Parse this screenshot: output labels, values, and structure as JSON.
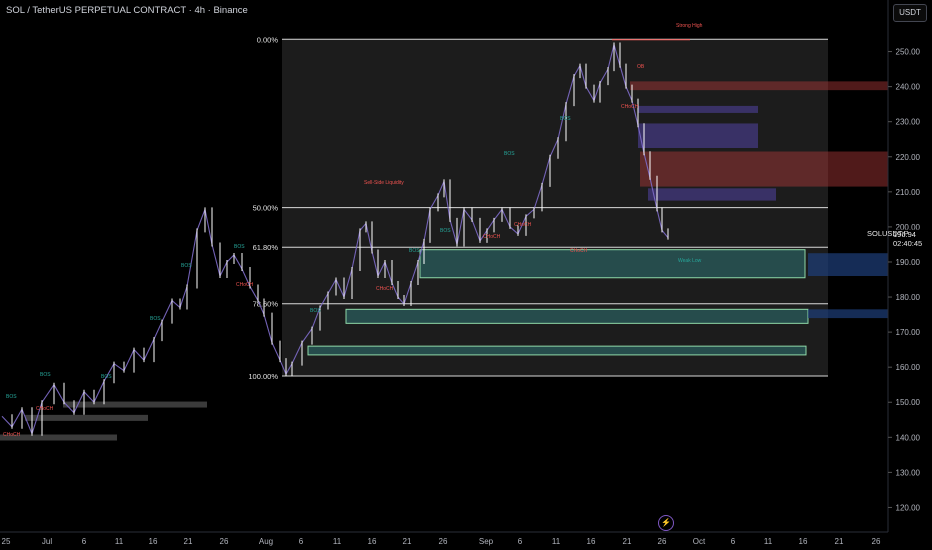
{
  "header": {
    "title": "SOL / TetherUS PERPETUAL CONTRACT · 4h · Binance",
    "currency_button": "USDT"
  },
  "price_tag": {
    "symbol": "SOLUSDT.P",
    "price": "196.94",
    "countdown": "02:40:45"
  },
  "icons": {
    "lightning": "lightning-icon"
  },
  "colors": {
    "background": "#000000",
    "candle": "#ffffff",
    "wick_line": "#7e6cc9",
    "fib_line": "#d9d9d9",
    "zone_green": "#8fd9a8",
    "zone_teal": "#3aa6a6",
    "zone_red": "#b23a3a",
    "zone_purple": "#4a3d8f",
    "bos_green": "#26a69a",
    "choch_red": "#ef5350"
  },
  "chart_data": {
    "type": "candlestick",
    "symbol": "SOL / TetherUS PERPETUAL CONTRACT",
    "timeframe": "4h",
    "exchange": "Binance",
    "y_axis": {
      "ticks": [
        120,
        130,
        140,
        150,
        160,
        170,
        180,
        190,
        200,
        210,
        220,
        230,
        240,
        250
      ],
      "range": [
        113,
        259
      ],
      "side": "right"
    },
    "x_axis": {
      "tick_labels": [
        "25",
        "Jul",
        "6",
        "11",
        "16",
        "21",
        "26",
        "Aug",
        "6",
        "11",
        "16",
        "21",
        "26",
        "Sep",
        "6",
        "11",
        "16",
        "21",
        "26",
        "Oct",
        "6",
        "11",
        "16",
        "21",
        "26"
      ]
    },
    "last_price": 196.94,
    "price_path": [
      [
        0,
        146
      ],
      [
        10,
        143
      ],
      [
        20,
        148
      ],
      [
        30,
        141
      ],
      [
        40,
        150
      ],
      [
        52,
        155
      ],
      [
        62,
        150
      ],
      [
        72,
        147
      ],
      [
        82,
        153
      ],
      [
        92,
        150
      ],
      [
        102,
        156
      ],
      [
        112,
        161
      ],
      [
        122,
        159
      ],
      [
        132,
        165
      ],
      [
        142,
        162
      ],
      [
        152,
        168
      ],
      [
        160,
        173
      ],
      [
        170,
        179
      ],
      [
        178,
        177
      ],
      [
        185,
        183
      ],
      [
        195,
        199
      ],
      [
        203,
        205
      ],
      [
        210,
        195
      ],
      [
        218,
        186
      ],
      [
        225,
        190
      ],
      [
        232,
        192
      ],
      [
        240,
        188
      ],
      [
        248,
        183
      ],
      [
        256,
        179
      ],
      [
        262,
        175
      ],
      [
        270,
        167
      ],
      [
        278,
        162
      ],
      [
        284,
        158
      ],
      [
        290,
        161
      ],
      [
        300,
        167
      ],
      [
        310,
        171
      ],
      [
        318,
        177
      ],
      [
        326,
        181
      ],
      [
        334,
        185
      ],
      [
        342,
        180
      ],
      [
        350,
        188
      ],
      [
        358,
        199
      ],
      [
        364,
        201
      ],
      [
        370,
        193
      ],
      [
        376,
        186
      ],
      [
        383,
        190
      ],
      [
        390,
        184
      ],
      [
        396,
        180
      ],
      [
        402,
        178
      ],
      [
        409,
        184
      ],
      [
        416,
        190
      ],
      [
        422,
        196
      ],
      [
        428,
        205
      ],
      [
        436,
        209
      ],
      [
        442,
        213
      ],
      [
        448,
        202
      ],
      [
        455,
        195
      ],
      [
        462,
        205
      ],
      [
        470,
        202
      ],
      [
        478,
        196
      ],
      [
        485,
        199
      ],
      [
        492,
        202
      ],
      [
        500,
        205
      ],
      [
        508,
        200
      ],
      [
        516,
        198
      ],
      [
        524,
        203
      ],
      [
        532,
        205
      ],
      [
        540,
        212
      ],
      [
        548,
        220
      ],
      [
        556,
        225
      ],
      [
        564,
        235
      ],
      [
        572,
        243
      ],
      [
        578,
        246
      ],
      [
        584,
        240
      ],
      [
        592,
        236
      ],
      [
        598,
        241
      ],
      [
        606,
        245
      ],
      [
        612,
        252
      ],
      [
        618,
        246
      ],
      [
        624,
        240
      ],
      [
        630,
        236
      ],
      [
        636,
        229
      ],
      [
        642,
        221
      ],
      [
        648,
        214
      ],
      [
        655,
        205
      ],
      [
        660,
        199
      ],
      [
        666,
        196.94
      ]
    ],
    "fibonacci": [
      {
        "level": "0.00%",
        "price": 253.5
      },
      {
        "level": "50.00%",
        "price": 205.5
      },
      {
        "level": "61.80%",
        "price": 194.2
      },
      {
        "level": "78.60%",
        "price": 178.1
      },
      {
        "level": "100.00%",
        "price": 157.5
      }
    ],
    "zones": [
      {
        "kind": "support",
        "top": 193.5,
        "bottom": 185.5
      },
      {
        "kind": "support",
        "top": 176.5,
        "bottom": 172.5
      },
      {
        "kind": "support",
        "top": 166.0,
        "bottom": 163.5
      },
      {
        "kind": "supply",
        "top": 221.5,
        "bottom": 211.5
      },
      {
        "kind": "supply",
        "top": 241.5,
        "bottom": 239.0
      },
      {
        "kind": "imbalance",
        "top": 229.5,
        "bottom": 222.5
      },
      {
        "kind": "imbalance",
        "top": 234.5,
        "bottom": 232.5
      },
      {
        "kind": "imbalance",
        "top": 211.0,
        "bottom": 207.5
      }
    ],
    "annotations": {
      "bos": [
        "BOS",
        "BOS",
        "BOS",
        "BOS",
        "BOS",
        "BOS",
        "BOS",
        "BOS",
        "BOS",
        "BOS",
        "BOS"
      ],
      "choch": [
        "CHoCH",
        "CHoCH",
        "CHoCH",
        "CHoCH",
        "CHoCH",
        "CHoCH",
        "CHoCH",
        "CHoCH"
      ],
      "other": [
        "Strong High",
        "OB",
        "Sell-Side Liquidity",
        "Weak Low"
      ]
    },
    "grid": false
  }
}
